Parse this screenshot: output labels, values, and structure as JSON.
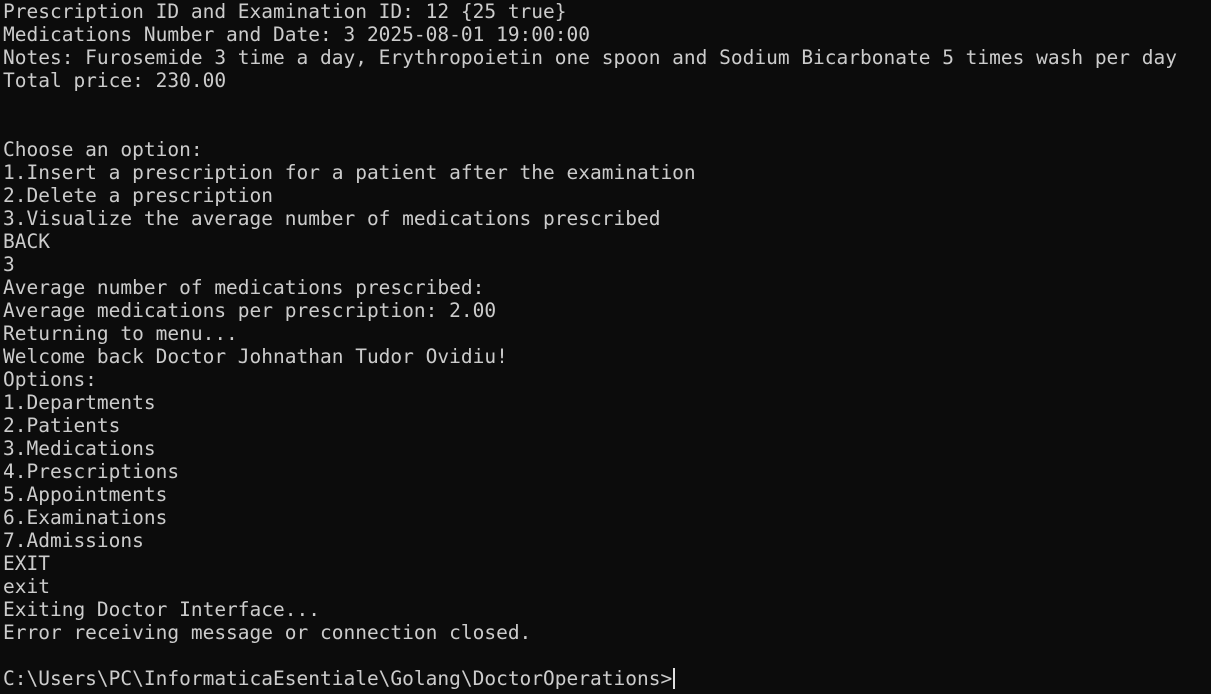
{
  "terminal": {
    "lines": [
      "Prescription ID and Examination ID: 12 {25 true}",
      "Medications Number and Date: 3 2025-08-01 19:00:00",
      "Notes: Furosemide 3 time a day, Erythropoietin one spoon and Sodium Bicarbonate 5 times wash per day",
      "Total price: 230.00",
      "",
      "",
      "Choose an option:",
      "1.Insert a prescription for a patient after the examination",
      "2.Delete a prescription",
      "3.Visualize the average number of medications prescribed",
      "BACK",
      "3",
      "Average number of medications prescribed:",
      "Average medications per prescription: 2.00",
      "Returning to menu...",
      "Welcome back Doctor Johnathan Tudor Ovidiu!",
      "Options:",
      "1.Departments",
      "2.Patients",
      "3.Medications",
      "4.Prescriptions",
      "5.Appointments",
      "6.Examinations",
      "7.Admissions",
      "EXIT",
      "exit",
      "Exiting Doctor Interface...",
      "Error receiving message or connection closed.",
      "",
      "C:\\Users\\PC\\InformaticaEsentiale\\Golang\\DoctorOperations>"
    ]
  },
  "colors": {
    "background": "#0c0c0c",
    "foreground": "#cccccc"
  }
}
